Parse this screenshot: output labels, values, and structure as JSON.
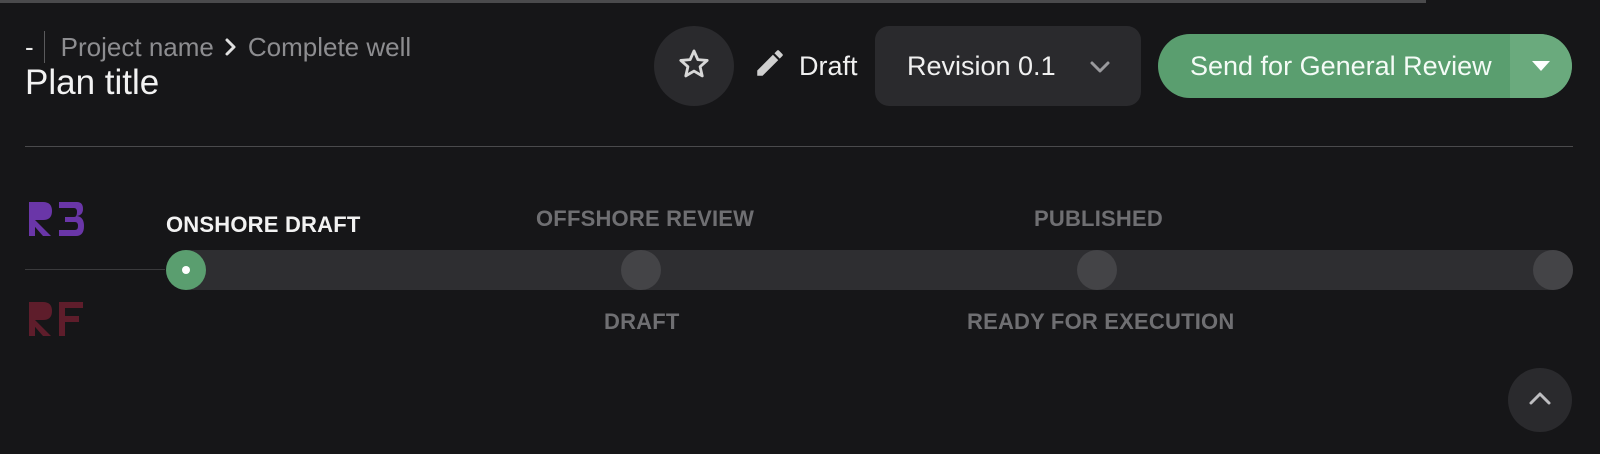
{
  "breadcrumb": {
    "dash": "-",
    "project": "Project name",
    "item": "Complete well"
  },
  "plan_title": "Plan title",
  "status": {
    "label": "Draft",
    "icon": "pencil-icon"
  },
  "revision": {
    "selected": "Revision 0.1"
  },
  "primary_action": {
    "label": "Send for General Review",
    "icon": "caret-down-icon"
  },
  "logos": {
    "top": "R3",
    "bottom": "RF"
  },
  "stepper": {
    "current_index": 0,
    "stages_top": [
      "ONSHORE DRAFT",
      "OFFSHORE REVIEW",
      "PUBLISHED"
    ],
    "stages_bottom": [
      "DRAFT",
      "READY FOR EXECUTION"
    ]
  },
  "colors": {
    "background": "#161618",
    "accent_green": "#5a9e6f",
    "logo_purple": "#6a36a8",
    "logo_red": "#5e1d2b"
  }
}
